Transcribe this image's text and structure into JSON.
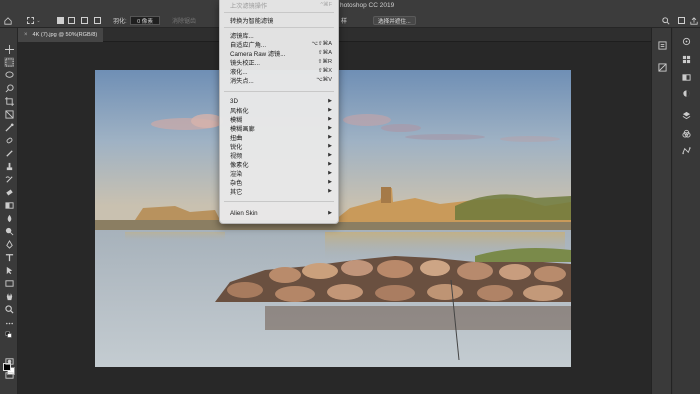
{
  "app": {
    "title": "hotoshop CC 2019",
    "document_tab": "4K (7).jpg @ 50%(RGB/8)",
    "close_glyph": "×"
  },
  "options_bar": {
    "feather_label": "羽化:",
    "feather_value": "0 像素",
    "anti_alias_label": "消除锯齿",
    "style_label": "样",
    "select_mask_button": "选择并遮住..."
  },
  "filter_menu": {
    "items": [
      {
        "label": "上次滤镜操作",
        "shortcut": "^⌘F",
        "disabled": true
      },
      {
        "label": "转换为智能滤镜",
        "shortcut": ""
      },
      {
        "label": "滤镜库...",
        "shortcut": ""
      },
      {
        "label": "自适应广角...",
        "shortcut": "⌥⇧⌘A"
      },
      {
        "label": "Camera Raw 滤镜...",
        "shortcut": "⇧⌘A"
      },
      {
        "label": "镜头校正...",
        "shortcut": "⇧⌘R"
      },
      {
        "label": "液化...",
        "shortcut": "⇧⌘X"
      },
      {
        "label": "消失点...",
        "shortcut": "⌥⌘V"
      },
      {
        "label": "3D",
        "submenu": true
      },
      {
        "label": "风格化",
        "submenu": true
      },
      {
        "label": "模糊",
        "submenu": true
      },
      {
        "label": "模糊画廊",
        "submenu": true
      },
      {
        "label": "扭曲",
        "submenu": true
      },
      {
        "label": "锐化",
        "submenu": true
      },
      {
        "label": "视频",
        "submenu": true
      },
      {
        "label": "像素化",
        "submenu": true
      },
      {
        "label": "渲染",
        "submenu": true
      },
      {
        "label": "杂色",
        "submenu": true
      },
      {
        "label": "其它",
        "submenu": true
      },
      {
        "label": "Alien Skin",
        "submenu": true
      }
    ],
    "submenu_arrow": "▶"
  },
  "colors": {
    "menu_bg": "#e8e8e8",
    "panel_bg": "#3a3a3a",
    "canvas_bg": "#282828"
  }
}
